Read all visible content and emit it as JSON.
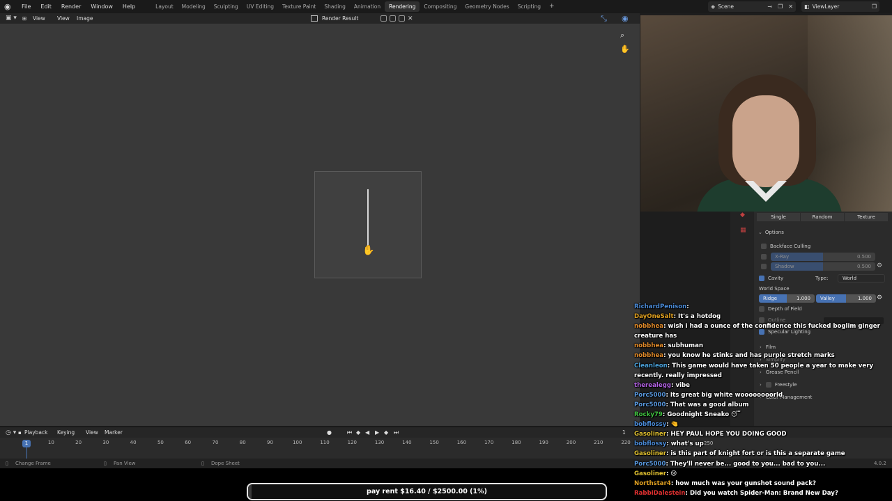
{
  "menubar": {
    "menus": [
      "File",
      "Edit",
      "Render",
      "Window",
      "Help"
    ],
    "workspaces": [
      "Layout",
      "Modeling",
      "Sculpting",
      "UV Editing",
      "Texture Paint",
      "Shading",
      "Animation",
      "Rendering",
      "Compositing",
      "Geometry Nodes",
      "Scripting"
    ],
    "active_workspace": "Rendering",
    "add_symbol": "+",
    "scene": "Scene",
    "view_layer": "ViewLayer"
  },
  "image_editor": {
    "menus": [
      "View",
      "View",
      "Image"
    ],
    "image_name": "Render Result"
  },
  "properties": {
    "color_modes": [
      "Single",
      "Random",
      "Texture"
    ],
    "options_header": "Options",
    "backface_culling": "Backface Culling",
    "xray_label": "X-Ray",
    "xray_value": "0.500",
    "shadow_label": "Shadow",
    "shadow_value": "0.500",
    "cavity_label": "Cavity",
    "type_label": "Type:",
    "type_value": "World",
    "world_space": "World Space",
    "ridge_label": "Ridge",
    "ridge_value": "1.000",
    "valley_label": "Valley",
    "valley_value": "1.000",
    "depth_of_field": "Depth of Field",
    "outline": "Outline",
    "specular": "Specular Lighting",
    "film": "Film",
    "simplify": "Simplify",
    "grease_pencil": "Grease Pencil",
    "freestyle": "Freestyle",
    "color_management": "Color Management"
  },
  "timeline": {
    "menus": [
      "Playback",
      "Keying",
      "View",
      "Marker"
    ],
    "current_frame": "1",
    "ticks": [
      "10",
      "20",
      "30",
      "40",
      "50",
      "60",
      "70",
      "80",
      "90",
      "100",
      "110",
      "120",
      "130",
      "140",
      "150",
      "160",
      "170",
      "180",
      "190",
      "200",
      "210",
      "220"
    ],
    "frame_field": "1",
    "end_frame": "250"
  },
  "statusbar": {
    "change_frame": "Change Frame",
    "pan_view": "Pan View",
    "dope_sheet": "Dope Sheet",
    "version": "4.0.2"
  },
  "goal": {
    "text": "pay rent $16.40 / $2500.00 (1%)",
    "fraction": 0.01
  },
  "chat": [
    {
      "user": "RichardPenison",
      "text": "",
      "color": "#4a8ad6"
    },
    {
      "user": "DayOneSalt",
      "text": "It's a hotdog",
      "color": "#e0a020"
    },
    {
      "user": "nobbhea",
      "text": "wish i had a ounce of the confidence this fucked boglim ginger creature has",
      "color": "#e08a2a"
    },
    {
      "user": "nobbhea",
      "text": "subhuman",
      "color": "#e08a2a"
    },
    {
      "user": "nobbhea",
      "text": "you know he stinks and has purple stretch marks",
      "color": "#e08a2a"
    },
    {
      "user": "Cleanleon",
      "text": "This game would have taken 50 people a year to make very recently. really impressed",
      "color": "#4aa0d8"
    },
    {
      "user": "therealegg",
      "text": "vibe",
      "color": "#b060e0"
    },
    {
      "user": "Porc5000",
      "text": "Its great big white woooooooorld",
      "color": "#5a9ae0"
    },
    {
      "user": "Porc5000",
      "text": "That was a good album",
      "color": "#5a9ae0"
    },
    {
      "user": "Rocky79",
      "text": "Goodnight Sneako 😴",
      "color": "#40c040"
    },
    {
      "user": "bobflossy",
      "text": "🤏",
      "color": "#4a8ad6"
    },
    {
      "user": "Gasoliner",
      "text": "HEY PAUL HOPE YOU DOING GOOD",
      "color": "#e0c030"
    },
    {
      "user": "bobflossy",
      "text": "what's up",
      "color": "#4a8ad6"
    },
    {
      "user": "Gasoliner",
      "text": "is this part of knight fort or is this a separate game",
      "color": "#e0c030"
    },
    {
      "user": "Porc5000",
      "text": "They'll never be... good to you... bad to you...",
      "color": "#5a9ae0"
    },
    {
      "user": "Gasoliner",
      "text": "😢",
      "color": "#e0c030"
    },
    {
      "user": "Northstar4",
      "text": "how much was your gunshot sound pack?",
      "color": "#e0a020"
    },
    {
      "user": "RabbiDalestein",
      "text": "Did you watch Spider-Man: Brand New Day?",
      "color": "#e03030"
    }
  ]
}
